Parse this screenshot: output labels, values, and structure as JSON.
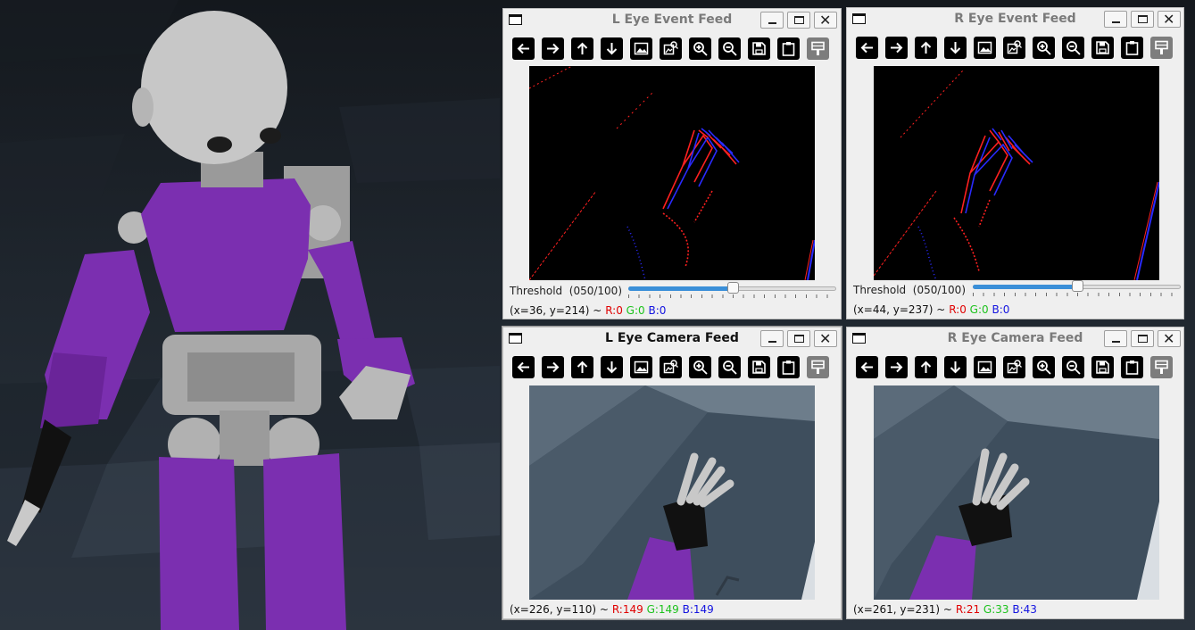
{
  "windows": {
    "l_event": {
      "title": "L Eye Event Feed",
      "threshold_label": "Threshold",
      "threshold_value": "(050/100)",
      "threshold_fraction": 0.5,
      "coords": "(x=36, y=214) ~",
      "r": "R:0",
      "g": "G:0",
      "b": "B:0"
    },
    "r_event": {
      "title": "R Eye Event Feed",
      "threshold_label": "Threshold",
      "threshold_value": "(050/100)",
      "threshold_fraction": 0.5,
      "coords": "(x=44, y=237) ~",
      "r": "R:0",
      "g": "G:0",
      "b": "B:0"
    },
    "l_camera": {
      "title": "L Eye Camera Feed",
      "coords": "(x=226, y=110) ~",
      "r": "R:149",
      "g": "G:149",
      "b": "B:149"
    },
    "r_camera": {
      "title": "R Eye Camera Feed",
      "coords": "(x=261, y=231) ~",
      "r": "R:21",
      "g": "G:33",
      "b": "B:43"
    }
  },
  "window_buttons": {
    "minimize": "minimize-icon",
    "maximize": "maximize-icon",
    "close": "✕"
  },
  "toolbar_icons": [
    "arrow-left-icon",
    "arrow-right-icon",
    "arrow-up-icon",
    "arrow-down-icon",
    "image-icon",
    "image-search-icon",
    "zoom-in-icon",
    "zoom-out-icon",
    "save-icon",
    "clipboard-icon",
    "properties-icon"
  ],
  "colors": {
    "robot_purple": "#7b2fb0",
    "accent_blue": "#3a8fd8",
    "event_red": "#ff1e1e",
    "event_blue": "#2a2aff"
  }
}
